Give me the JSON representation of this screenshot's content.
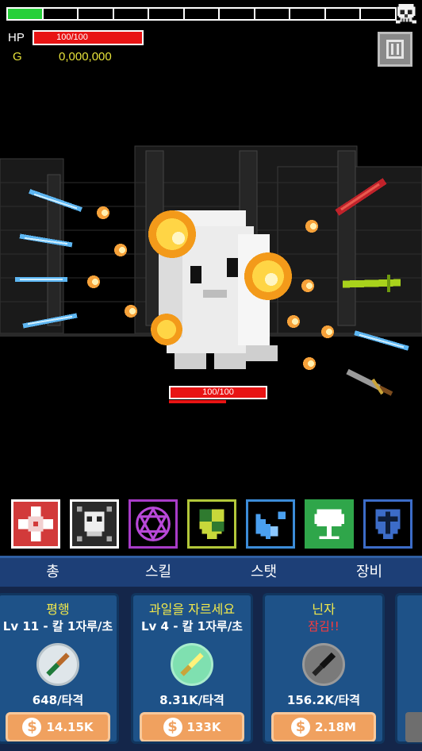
{
  "stage": {
    "total_segments": 11,
    "filled_segments": 1
  },
  "player": {
    "hp_label": "HP",
    "hp_text": "100/100",
    "hp_fraction": 1.0,
    "gold_label": "G",
    "gold_value": "0,000,000"
  },
  "boss": {
    "hp_text": "100/100",
    "hp_fraction": 1.0
  },
  "skills": [
    {
      "name": "skill-cross-flame",
      "border": "#ffffff",
      "bg": "#d23a3a"
    },
    {
      "name": "skill-skull",
      "border": "#ffffff",
      "bg": "#2a2a2a"
    },
    {
      "name": "skill-hexagram",
      "border": "#a83cc8",
      "bg": "#000000"
    },
    {
      "name": "skill-shield",
      "border": "#b3c83a",
      "bg": "#000000"
    },
    {
      "name": "skill-wings",
      "border": "#3c8cd8",
      "bg": "#000000"
    },
    {
      "name": "skill-tree",
      "border": "#2fa64a",
      "bg": "#2fa64a"
    },
    {
      "name": "skill-cross-shield",
      "border": "#3c6cc8",
      "bg": "#000000"
    }
  ],
  "tabs": [
    "총",
    "스킬",
    "스탯",
    "장비"
  ],
  "cards": [
    {
      "title": "평행",
      "sub": "Lv 11 - 칼 1자루/초",
      "locked": false,
      "dmg": "648/타격",
      "price": "14.15K",
      "weapon": "green-knife"
    },
    {
      "title": "과일을 자르세요",
      "sub": "Lv 4 - 칼 1자루/초",
      "locked": false,
      "dmg": "8.31K/타격",
      "price": "133K",
      "weapon": "yellow-knife"
    },
    {
      "title": "닌자",
      "sub": "잠김!!",
      "locked": true,
      "dmg": "156.2K/타격",
      "price": "2.18M",
      "weapon": "black-knife"
    }
  ],
  "coin_symbol": "$"
}
